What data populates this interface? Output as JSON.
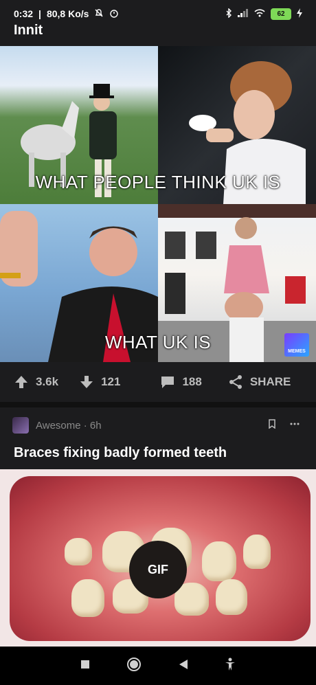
{
  "status_bar": {
    "time": "0:32",
    "network_speed": "80,8 Ko/s",
    "battery_level": "62"
  },
  "header": {
    "title": "Innit"
  },
  "meme": {
    "caption_top": "WHAT PEOPLE THINK UK IS",
    "caption_bottom": "WHAT UK IS",
    "badge_text": "MEMES"
  },
  "actions": {
    "upvotes": "3.6k",
    "downvotes": "121",
    "comments": "188",
    "share_label": "SHARE"
  },
  "next_post": {
    "meta": "Awesome · 6h",
    "title": "Braces fixing badly formed teeth",
    "media_label": "GIF"
  },
  "colors": {
    "background": "#1c1c1e",
    "battery": "#7ed957"
  }
}
